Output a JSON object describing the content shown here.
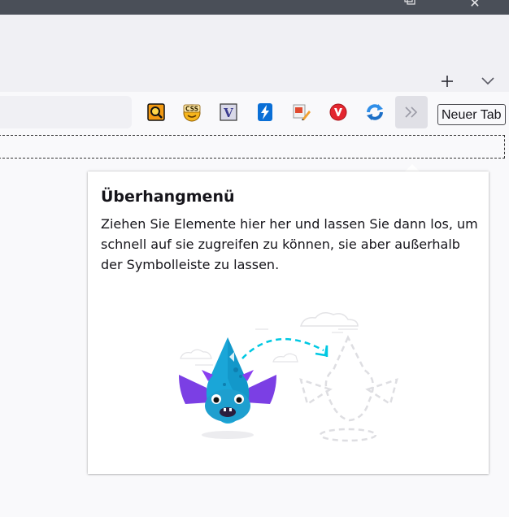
{
  "window": {
    "controls": {
      "restore_icon": "restore-icon",
      "close_glyph": "✕"
    }
  },
  "tabstrip": {
    "new_tab_icon": "plus-icon",
    "list_all_tabs_icon": "chevron-down-icon"
  },
  "toolbar": {
    "extensions": [
      {
        "icon": "magnifier-extension-icon",
        "color": "#f08c00"
      },
      {
        "icon": "css-extension-icon",
        "label": "CSS",
        "color": "#f5b30a"
      },
      {
        "icon": "v-extension-icon",
        "label": "V",
        "color": "#3b3b8f"
      },
      {
        "icon": "bolt-extension-icon",
        "color": "#0a72d8"
      },
      {
        "icon": "screenshot-edit-extension-icon",
        "color": "#d9452e"
      },
      {
        "icon": "vivaldi-extension-icon",
        "label": "V",
        "color": "#e3262f"
      },
      {
        "icon": "sync-extension-icon",
        "color": "#2f8ee8"
      }
    ],
    "overflow_button_icon": "double-chevron-right-icon",
    "tooltip": "Neuer Tab"
  },
  "overflow_panel": {
    "title": "Überhangmenü",
    "description": "Ziehen Sie Elemente hier her und lassen Sie dann los, um schnell auf sie zugreifen zu können, sie aber außerhalb der Symbolleiste zu lassen.",
    "illustration": "dragon-drag-illustration",
    "accent_color": "#00b3d7"
  }
}
